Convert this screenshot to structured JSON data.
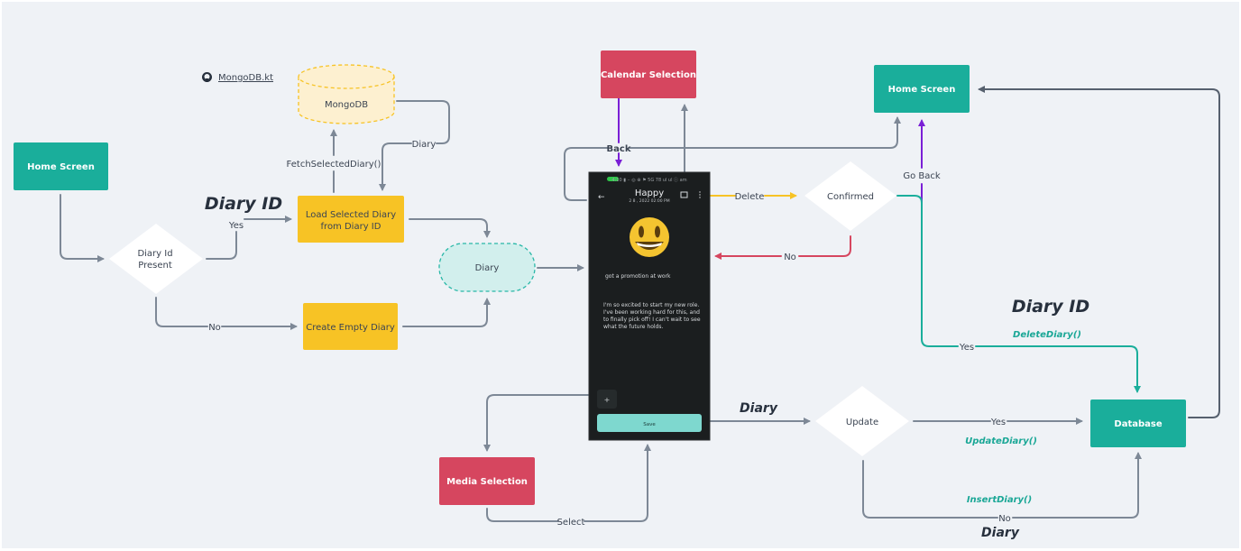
{
  "colors": {
    "background": "#eff2f6",
    "teal_node": "#1aae9b",
    "red_node": "#d6465f",
    "yellow_node": "#f7c325",
    "db_dashed_fill": "#fdf0d0",
    "db_dashed_stroke": "#f7c325",
    "diary_pill_fill": "#d2efed",
    "diary_pill_stroke": "#2ab8a8",
    "edge_gray": "#7d8896",
    "edge_dark": "#56606e",
    "edge_purple": "#7a1fd6",
    "edge_yellow": "#f7c325",
    "edge_red": "#d6465f",
    "edge_teal": "#1aae9b",
    "phone_bg": "#1b1e1f",
    "phone_save_button": "#7ed8cf",
    "emoji_yellow": "#f4c430"
  },
  "link": {
    "icon": "github-icon",
    "label": "MongoDB.kt"
  },
  "nodes": {
    "home_screen_left": "Home Screen",
    "diary_id_present": [
      "Diary Id",
      "Present"
    ],
    "load_selected_diary": [
      "Load Selected Diary",
      "from Diary ID"
    ],
    "create_empty_diary": "Create Empty Diary",
    "mongodb": "MongoDB",
    "diary_pill": "Diary",
    "calendar_selection": "Calendar Selection",
    "media_selection": "Media Selection",
    "home_screen_right": "Home Screen",
    "confirmed": "Confirmed",
    "update": "Update",
    "database": "Database"
  },
  "edges": {
    "yes_diary_id": "Yes",
    "no_create": "No",
    "fetch_selected_diary": "FetchSelectedDiary()",
    "diary_return": "Diary",
    "back": "Back",
    "delete": "Delete",
    "no_confirmed": "No",
    "go_back": "Go Back",
    "yes_delete": "Yes",
    "yes_update": "Yes",
    "no_insert": "No",
    "select": "Select"
  },
  "annotations": {
    "diary_id_left": "Diary ID",
    "diary_id_right": "Diary ID",
    "diary_save": "Diary",
    "diary_insert": "Diary",
    "delete_fn": "DeleteDiary()",
    "update_fn": "UpdateDiary()",
    "insert_fn": "InsertDiary()"
  },
  "phone": {
    "status_bar": "4:10 ▮ ·· ◎ ⊕ ⚑ 5G 78 ul ul ⓘ am",
    "title": "Happy",
    "subtitle": "2 8 , 2022 02:00 PM",
    "mood_emoji": "😃",
    "entry_title": "got a promotion at work",
    "entry_body": [
      "I'm so excited to start my new role.",
      "I've been working hard for this, and",
      "to finally pick off! I can't wait to see",
      "what the future holds."
    ],
    "add_media_label": "+",
    "save_label": "Save"
  }
}
